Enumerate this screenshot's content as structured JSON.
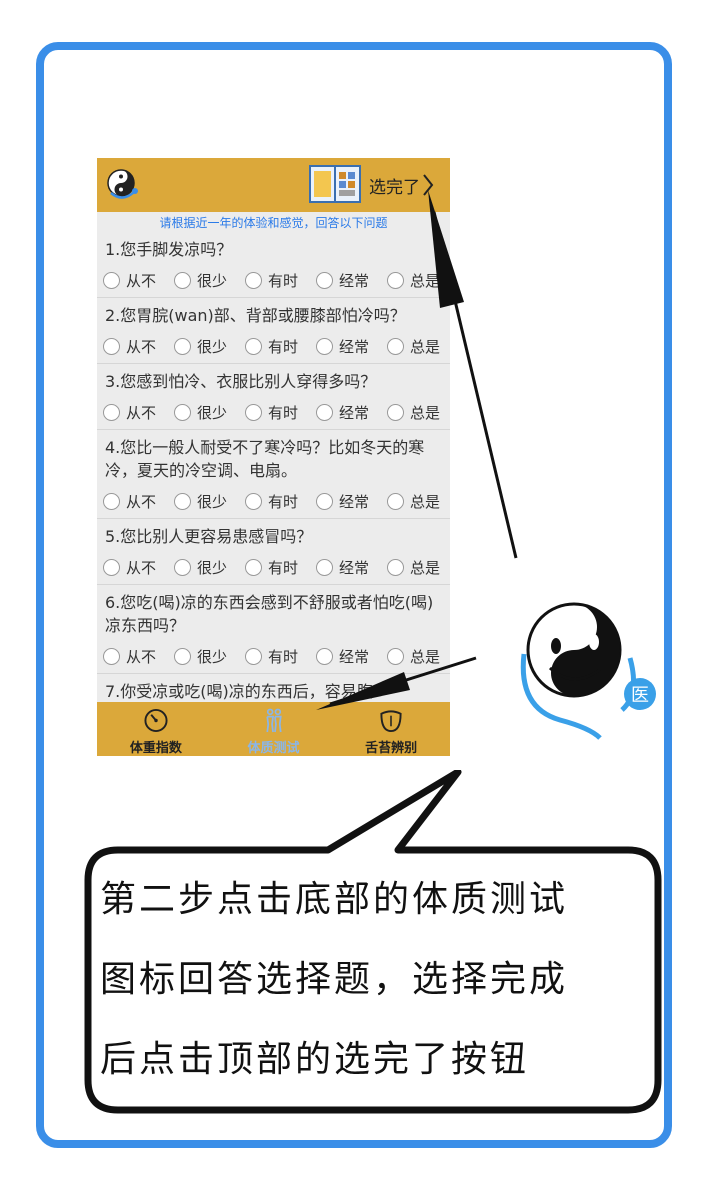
{
  "header": {
    "done_label": "选完了",
    "logo_icon": "yin-yang-icon",
    "book_icon": "book-icon"
  },
  "subtitle": "请根据近一年的体验和感觉，回答以下问题",
  "options": [
    "从不",
    "很少",
    "有时",
    "经常",
    "总是"
  ],
  "questions": [
    {
      "text": "1.您手脚发凉吗？"
    },
    {
      "text": "2.您胃脘(wan)部、背部或腰膝部怕冷吗？"
    },
    {
      "text": "3.您感到怕冷、衣服比别人穿得多吗？"
    },
    {
      "text": "4.您比一般人耐受不了寒冷吗？比如冬天的寒冷，夏天的冷空调、电扇。"
    },
    {
      "text": "5.您比别人更容易患感冒吗？"
    },
    {
      "text": "6.您吃(喝)凉的东西会感到不舒服或者怕吃(喝)凉东西吗？"
    },
    {
      "text": "7.你受凉或吃(喝)凉的东西后，容易腹"
    }
  ],
  "tabs": [
    {
      "label": "体重指数",
      "icon": "gauge-icon",
      "active": false
    },
    {
      "label": "体质测试",
      "icon": "body-icon",
      "active": true
    },
    {
      "label": "舌苔辨别",
      "icon": "tongue-icon",
      "active": false
    }
  ],
  "mascot": {
    "badge": "医"
  },
  "bubble": {
    "lines": [
      "第二步点击底部的体质测试",
      "图标回答选择题，选择完成",
      "后点击顶部的选完了按钮"
    ]
  },
  "colors": {
    "frame": "#3a8ee8",
    "bar": "#dba83a",
    "subtitle": "#2a7ae8"
  }
}
